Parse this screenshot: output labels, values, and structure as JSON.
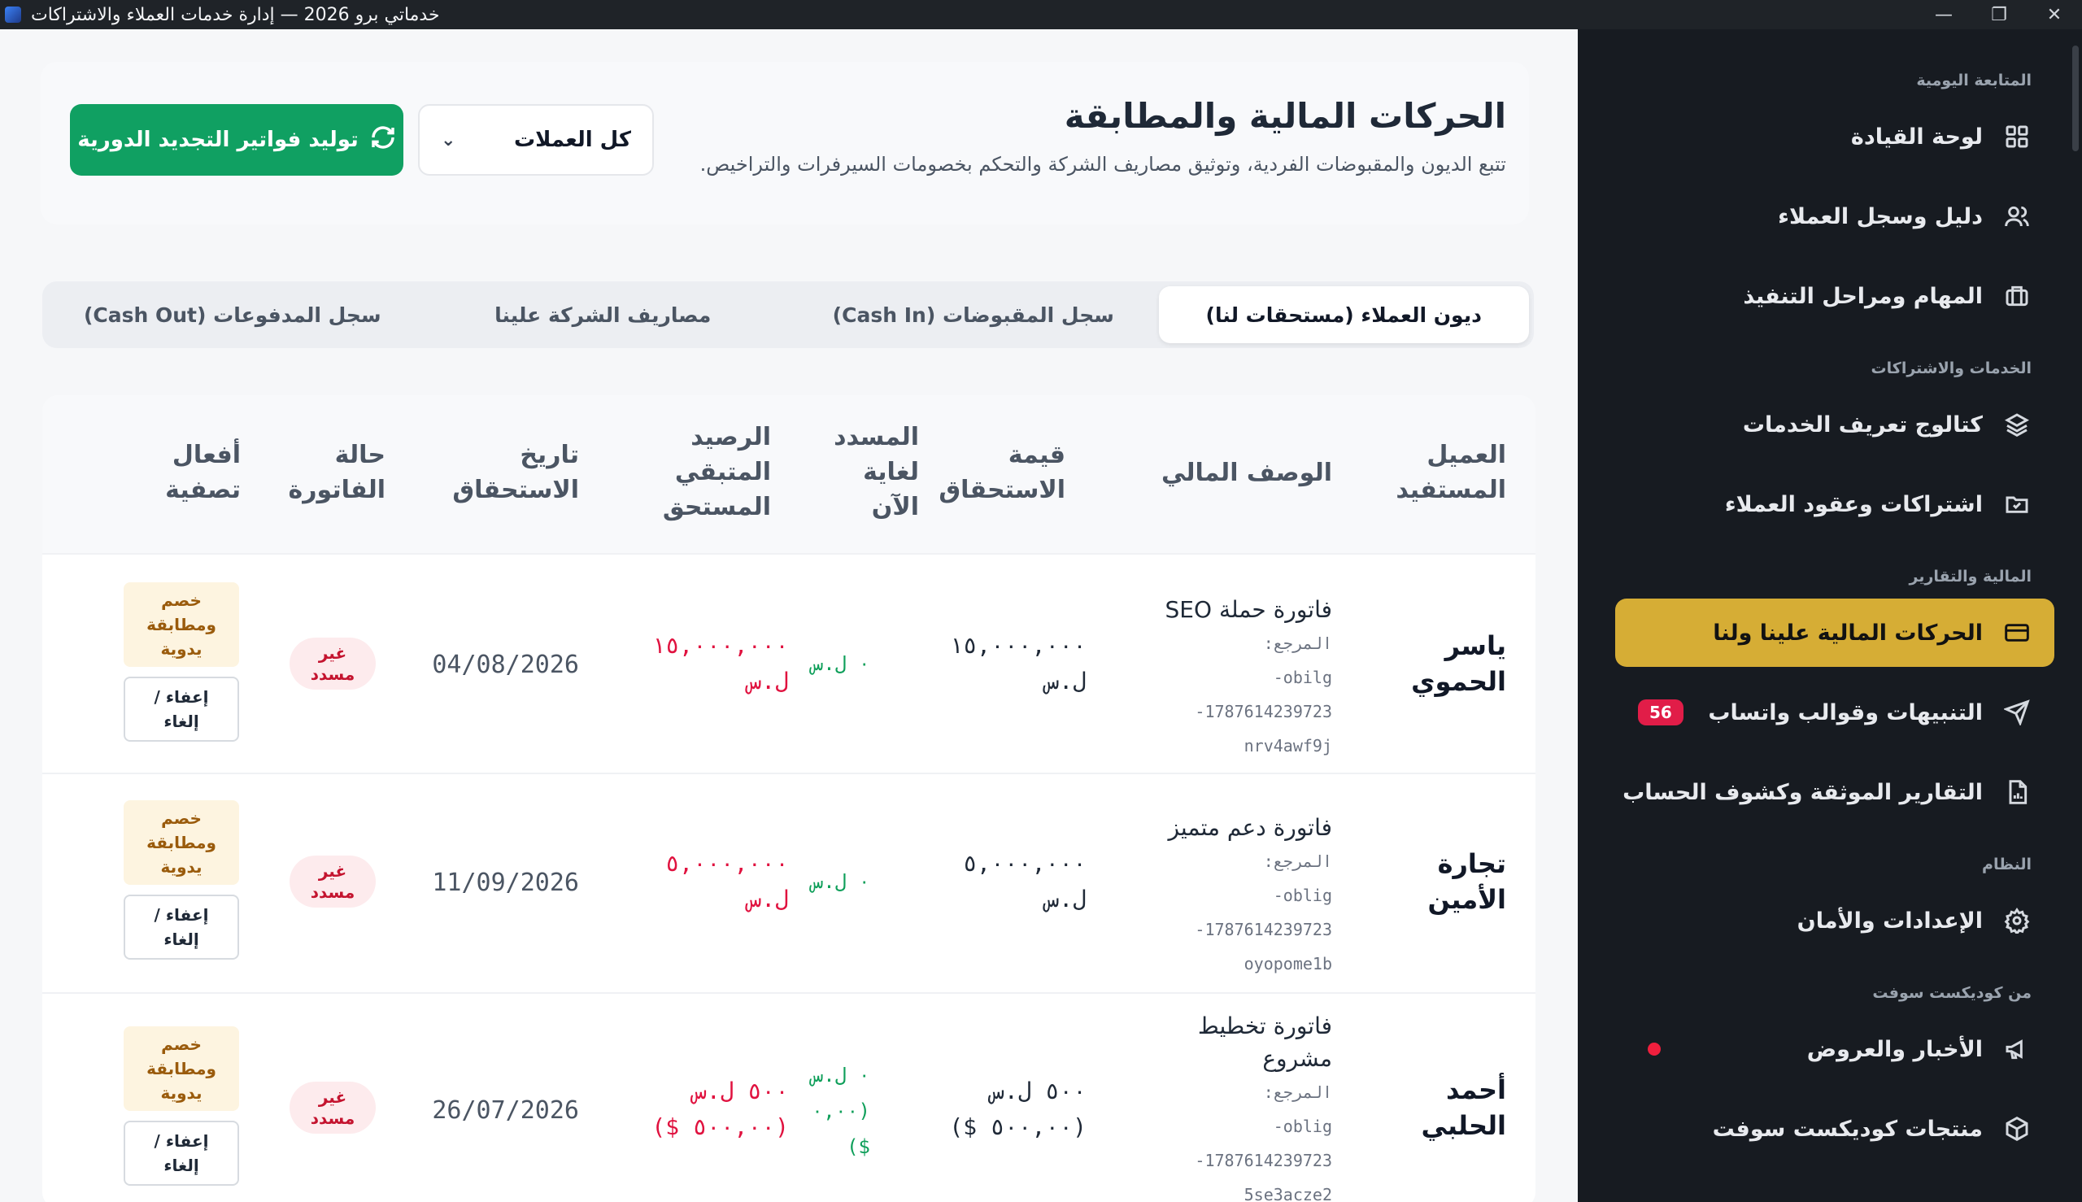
{
  "window": {
    "title": "خدماتي برو 2026 — إدارة خدمات العملاء والاشتراكات",
    "minimize": "—",
    "maximize": "❐",
    "close": "✕"
  },
  "sidebar": {
    "sections": [
      {
        "label": "المتابعة اليومية"
      },
      {
        "label": "الخدمات والاشتراكات"
      },
      {
        "label": "المالية والتقارير"
      },
      {
        "label": "النظام"
      },
      {
        "label": "من كوديكست سوفت"
      }
    ],
    "items": [
      {
        "label": "لوحة القيادة",
        "icon": "dashboard-icon"
      },
      {
        "label": "دليل وسجل العملاء",
        "icon": "users-icon"
      },
      {
        "label": "المهام ومراحل التنفيذ",
        "icon": "briefcase-icon"
      },
      {
        "label": "كتالوج تعريف الخدمات",
        "icon": "layers-icon"
      },
      {
        "label": "اشتراكات وعقود العملاء",
        "icon": "folder-check-icon"
      },
      {
        "label": "الحركات المالية علينا ولنا",
        "icon": "credit-card-icon",
        "active": true
      },
      {
        "label": "التنبيهات وقوالب واتساب",
        "icon": "send-icon",
        "badge": "56"
      },
      {
        "label": "التقارير الموثقة وكشوف الحساب",
        "icon": "file-chart-icon"
      },
      {
        "label": "الإعدادات والأمان",
        "icon": "gear-icon"
      },
      {
        "label": "الأخبار والعروض",
        "icon": "megaphone-icon"
      },
      {
        "label": "منتجات كوديكست سوفت",
        "icon": "box-icon"
      }
    ],
    "accent_color": "#d6ad35"
  },
  "header": {
    "title": "الحركات المالية والمطابقة",
    "subtitle": "تتبع الديون والمقبوضات الفردية، وتوثيق مصاريف الشركة والتحكم بخصومات السيرفرات والتراخيص.",
    "currency_filter": "كل العملات",
    "generate_button": "توليد فواتير التجديد الدورية",
    "button_color": "#10a062"
  },
  "tabs": [
    {
      "label": "ديون العملاء (مستحقات لنا)",
      "active": true
    },
    {
      "label": "سجل المقبوضات (Cash In)"
    },
    {
      "label": "مصاريف الشركة علينا"
    },
    {
      "label": "سجل المدفوعات (Cash Out)"
    }
  ],
  "table": {
    "columns": {
      "client": [
        "العميل",
        "المستفيد"
      ],
      "description": [
        "الوصف المالي"
      ],
      "due_value": [
        "قيمة",
        "الاستحقاق"
      ],
      "paid": [
        "المسدد",
        "لغاية",
        "الآن"
      ],
      "remaining": [
        "الرصيد",
        "المتبقي",
        "المستحق"
      ],
      "due_date": [
        "تاريخ",
        "الاستحقاق"
      ],
      "status": [
        "حالة",
        "الفاتورة"
      ],
      "actions": [
        "أفعال",
        "تصفية"
      ]
    },
    "ref_label": "المرجع:",
    "rows": [
      {
        "client": [
          "ياسر",
          "الحموي"
        ],
        "desc": [
          "فاتورة حملة SEO"
        ],
        "ref": [
          "obilg-",
          "1787614239723-",
          "nrv4awf9j"
        ],
        "due": [
          "١٥,٠٠٠,٠٠٠",
          "ل.س"
        ],
        "paid": [
          "٠ ل.س"
        ],
        "remaining": [
          "١٥,٠٠٠,٠٠٠",
          "ل.س"
        ],
        "date": "04/08/2026",
        "status": [
          "غير",
          "مسدد"
        ],
        "match": [
          "خصم",
          "ومطابقة",
          "يدوية"
        ],
        "waive": [
          "إعفاء /",
          "إلغاء"
        ]
      },
      {
        "client": [
          "تجارة",
          "الأمين"
        ],
        "desc": [
          "فاتورة دعم متميز"
        ],
        "ref": [
          "oblig-",
          "1787614239723-",
          "oyopome1b"
        ],
        "due": [
          "٥,٠٠٠,٠٠٠",
          "ل.س"
        ],
        "paid": [
          "٠ ل.س"
        ],
        "remaining": [
          "٥,٠٠٠,٠٠٠",
          "ل.س"
        ],
        "date": "11/09/2026",
        "status": [
          "غير",
          "مسدد"
        ],
        "match": [
          "خصم",
          "ومطابقة",
          "يدوية"
        ],
        "waive": [
          "إعفاء /",
          "إلغاء"
        ]
      },
      {
        "client": [
          "أحمد",
          "الحلبي"
        ],
        "desc": [
          "فاتورة تخطيط",
          "مشروع"
        ],
        "ref": [
          "oblig-",
          "1787614239723-",
          "5se3acze2"
        ],
        "due": [
          "٥٠٠ ل.س",
          "(٥٠٠,٠٠ $)"
        ],
        "paid": [
          "٠ ل.س",
          "(٠,٠٠",
          "$)"
        ],
        "remaining": [
          "٥٠٠ ل.س",
          "(٥٠٠,٠٠ $)"
        ],
        "date": "26/07/2026",
        "status": [
          "غير",
          "مسدد"
        ],
        "match": [
          "خصم",
          "ومطابقة",
          "يدوية"
        ],
        "waive": [
          "إعفاء /",
          "إلغاء"
        ]
      }
    ]
  }
}
